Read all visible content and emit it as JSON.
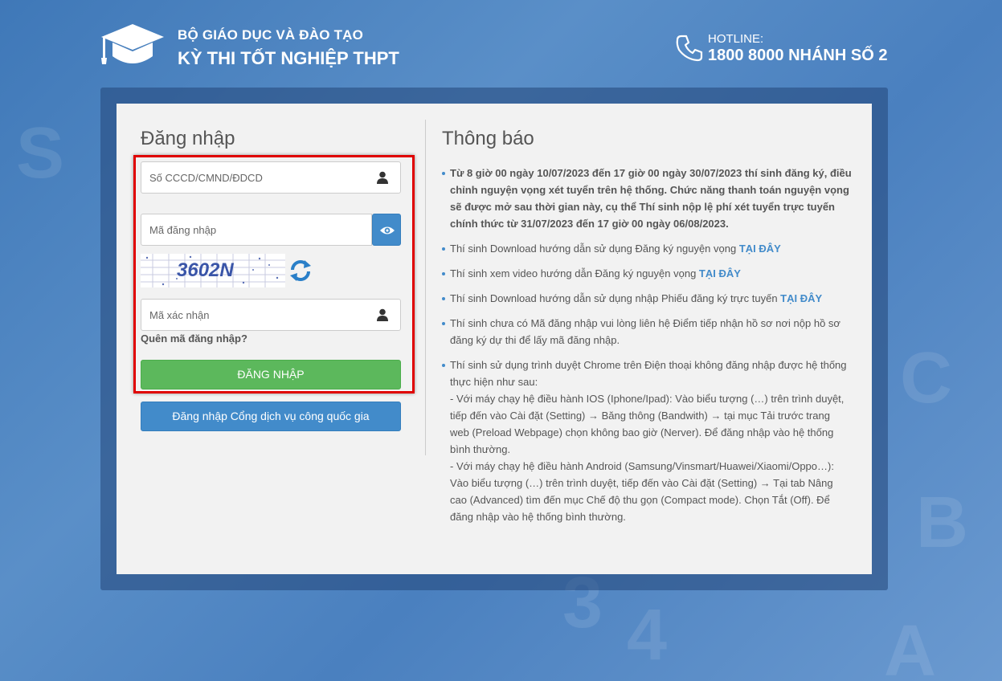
{
  "header": {
    "org_line1": "BỘ GIÁO DỤC VÀ ĐÀO TẠO",
    "org_line2": "KỲ THI TỐT NGHIỆP THPT",
    "hotline_label": "HOTLINE:",
    "hotline_number": "1800 8000 NHÁNH SỐ 2"
  },
  "login": {
    "title": "Đăng nhập",
    "id_placeholder": "Số CCCD/CMND/ĐDCD",
    "password_placeholder": "Mã đăng nhập",
    "captcha_text": "3602N",
    "captcha_placeholder": "Mã xác nhận",
    "forgot_label": "Quên mã đăng nhập?",
    "submit_label": "ĐĂNG NHẬP",
    "portal_label": "Đăng nhập Cổng dịch vụ công quốc gia"
  },
  "notice": {
    "title": "Thông báo",
    "item1": "Từ 8 giờ 00 ngày 10/07/2023 đến 17 giờ 00 ngày 30/07/2023 thí sinh đăng ký, điều chỉnh nguyện vọng xét tuyển trên hệ thống. Chức năng thanh toán nguyện vọng sẽ được mở sau thời gian này, cụ thể Thí sinh nộp lệ phí xét tuyển trực tuyến chính thức từ 31/07/2023 đến 17 giờ 00 ngày 06/08/2023.",
    "item2_text": "Thí sinh Download hướng dẫn sử dụng Đăng ký nguyện vọng ",
    "item2_link": "TẠI ĐÂY",
    "item3_text": "Thí sinh xem video hướng dẫn Đăng ký nguyện vọng ",
    "item3_link": "TẠI ĐÂY",
    "item4_text": "Thí sinh Download hướng dẫn sử dụng nhập Phiếu đăng ký trực tuyến ",
    "item4_link": "TẠI ĐÂY",
    "item5": "Thí sinh chưa có Mã đăng nhập vui lòng liên hệ Điểm tiếp nhận hồ sơ nơi nộp hồ sơ đăng ký dự thi để lấy mã đăng nhập.",
    "item6_intro": "Thí sinh sử dụng trình duyệt Chrome trên Điện thoại không đăng nhập được hệ thống thực hiện như sau:",
    "item6_ios": " - Với máy chạy hệ điều hành IOS (Iphone/Ipad): Vào biểu tượng (…) trên trình duyệt, tiếp đến vào Cài đặt (Setting) → Băng thông (Bandwith) → tại mục Tải trước trang web (Preload Webpage) chọn không bao giờ (Nerver). Để đăng nhập vào hệ thống bình thường.",
    "item6_android": " - Với máy chạy hệ điều hành Android (Samsung/Vinsmart/Huawei/Xiaomi/Oppo…): Vào biểu tượng (…) trên trình duyệt, tiếp đến vào Cài đặt (Setting) → Tại tab Nâng cao (Advanced) tìm đến mục Chế độ thu gọn (Compact mode). Chọn Tắt (Off). Để đăng nhập vào hệ thống bình thường."
  },
  "colors": {
    "primary_blue": "#428bca",
    "success_green": "#5cb85c",
    "highlight_red": "#e00000"
  }
}
